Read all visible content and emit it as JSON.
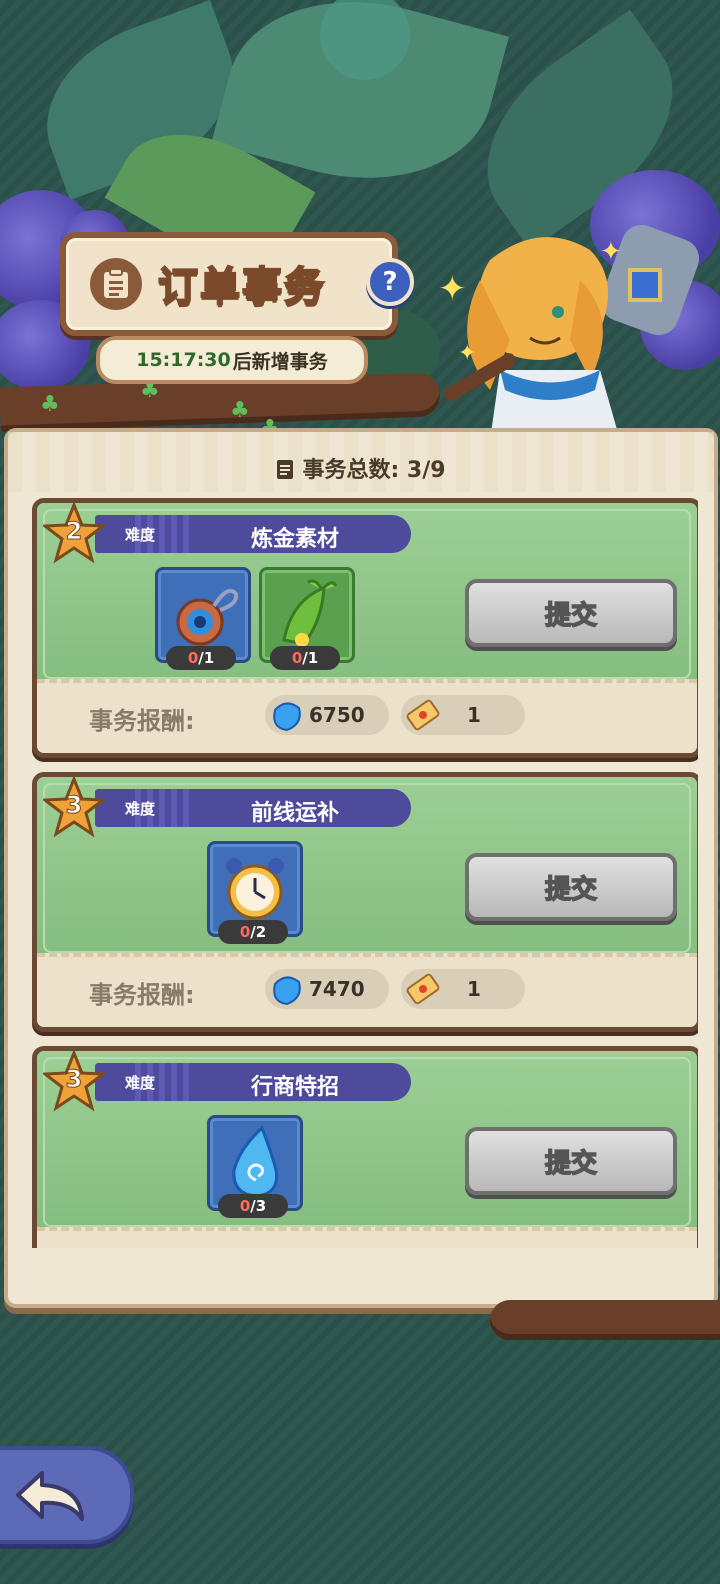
{
  "header": {
    "title": "订单事务",
    "help_label": "?",
    "timer": "15:17:30",
    "timer_suffix": "后新增事务"
  },
  "panel": {
    "total_label": "事务总数: 3/9"
  },
  "orders": [
    {
      "difficulty": "2",
      "difficulty_label": "难度",
      "title": "炼金素材",
      "items": [
        {
          "icon": "amulet-icon",
          "have": "0",
          "need": "/1"
        },
        {
          "icon": "sprout-horn-icon",
          "have": "0",
          "need": "/1"
        }
      ],
      "submit_label": "提交",
      "reward_label": "事务报酬:",
      "reward_gems": "6750",
      "reward_tickets": "1"
    },
    {
      "difficulty": "3",
      "difficulty_label": "难度",
      "title": "前线运补",
      "items": [
        {
          "icon": "alarm-clock-icon",
          "have": "0",
          "need": "/2"
        }
      ],
      "submit_label": "提交",
      "reward_label": "事务报酬:",
      "reward_gems": "7470",
      "reward_tickets": "1"
    },
    {
      "difficulty": "3",
      "difficulty_label": "难度",
      "title": "行商特招",
      "items": [
        {
          "icon": "water-drop-icon",
          "have": "0",
          "need": "/3"
        }
      ],
      "submit_label": "提交"
    }
  ],
  "colors": {
    "banner": "#4e4a9c",
    "card_green": "#8ec08a",
    "submit_gray": "#c8c8c8",
    "accent_red": "#ff6b5e"
  }
}
